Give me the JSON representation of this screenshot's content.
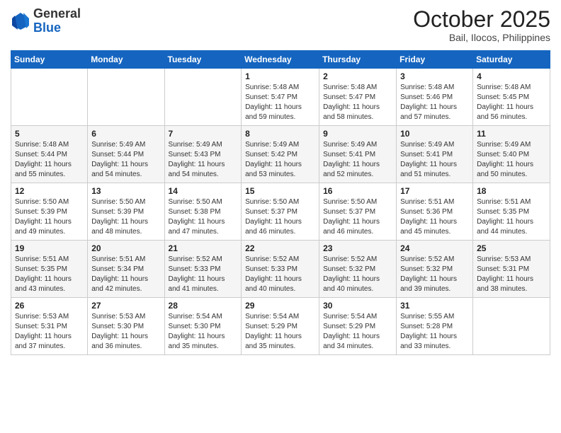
{
  "header": {
    "logo_general": "General",
    "logo_blue": "Blue",
    "month_year": "October 2025",
    "location": "Bail, Ilocos, Philippines"
  },
  "weekdays": [
    "Sunday",
    "Monday",
    "Tuesday",
    "Wednesday",
    "Thursday",
    "Friday",
    "Saturday"
  ],
  "weeks": [
    [
      {
        "day": "",
        "info": ""
      },
      {
        "day": "",
        "info": ""
      },
      {
        "day": "",
        "info": ""
      },
      {
        "day": "1",
        "info": "Sunrise: 5:48 AM\nSunset: 5:47 PM\nDaylight: 11 hours\nand 59 minutes."
      },
      {
        "day": "2",
        "info": "Sunrise: 5:48 AM\nSunset: 5:47 PM\nDaylight: 11 hours\nand 58 minutes."
      },
      {
        "day": "3",
        "info": "Sunrise: 5:48 AM\nSunset: 5:46 PM\nDaylight: 11 hours\nand 57 minutes."
      },
      {
        "day": "4",
        "info": "Sunrise: 5:48 AM\nSunset: 5:45 PM\nDaylight: 11 hours\nand 56 minutes."
      }
    ],
    [
      {
        "day": "5",
        "info": "Sunrise: 5:48 AM\nSunset: 5:44 PM\nDaylight: 11 hours\nand 55 minutes."
      },
      {
        "day": "6",
        "info": "Sunrise: 5:49 AM\nSunset: 5:44 PM\nDaylight: 11 hours\nand 54 minutes."
      },
      {
        "day": "7",
        "info": "Sunrise: 5:49 AM\nSunset: 5:43 PM\nDaylight: 11 hours\nand 54 minutes."
      },
      {
        "day": "8",
        "info": "Sunrise: 5:49 AM\nSunset: 5:42 PM\nDaylight: 11 hours\nand 53 minutes."
      },
      {
        "day": "9",
        "info": "Sunrise: 5:49 AM\nSunset: 5:41 PM\nDaylight: 11 hours\nand 52 minutes."
      },
      {
        "day": "10",
        "info": "Sunrise: 5:49 AM\nSunset: 5:41 PM\nDaylight: 11 hours\nand 51 minutes."
      },
      {
        "day": "11",
        "info": "Sunrise: 5:49 AM\nSunset: 5:40 PM\nDaylight: 11 hours\nand 50 minutes."
      }
    ],
    [
      {
        "day": "12",
        "info": "Sunrise: 5:50 AM\nSunset: 5:39 PM\nDaylight: 11 hours\nand 49 minutes."
      },
      {
        "day": "13",
        "info": "Sunrise: 5:50 AM\nSunset: 5:39 PM\nDaylight: 11 hours\nand 48 minutes."
      },
      {
        "day": "14",
        "info": "Sunrise: 5:50 AM\nSunset: 5:38 PM\nDaylight: 11 hours\nand 47 minutes."
      },
      {
        "day": "15",
        "info": "Sunrise: 5:50 AM\nSunset: 5:37 PM\nDaylight: 11 hours\nand 46 minutes."
      },
      {
        "day": "16",
        "info": "Sunrise: 5:50 AM\nSunset: 5:37 PM\nDaylight: 11 hours\nand 46 minutes."
      },
      {
        "day": "17",
        "info": "Sunrise: 5:51 AM\nSunset: 5:36 PM\nDaylight: 11 hours\nand 45 minutes."
      },
      {
        "day": "18",
        "info": "Sunrise: 5:51 AM\nSunset: 5:35 PM\nDaylight: 11 hours\nand 44 minutes."
      }
    ],
    [
      {
        "day": "19",
        "info": "Sunrise: 5:51 AM\nSunset: 5:35 PM\nDaylight: 11 hours\nand 43 minutes."
      },
      {
        "day": "20",
        "info": "Sunrise: 5:51 AM\nSunset: 5:34 PM\nDaylight: 11 hours\nand 42 minutes."
      },
      {
        "day": "21",
        "info": "Sunrise: 5:52 AM\nSunset: 5:33 PM\nDaylight: 11 hours\nand 41 minutes."
      },
      {
        "day": "22",
        "info": "Sunrise: 5:52 AM\nSunset: 5:33 PM\nDaylight: 11 hours\nand 40 minutes."
      },
      {
        "day": "23",
        "info": "Sunrise: 5:52 AM\nSunset: 5:32 PM\nDaylight: 11 hours\nand 40 minutes."
      },
      {
        "day": "24",
        "info": "Sunrise: 5:52 AM\nSunset: 5:32 PM\nDaylight: 11 hours\nand 39 minutes."
      },
      {
        "day": "25",
        "info": "Sunrise: 5:53 AM\nSunset: 5:31 PM\nDaylight: 11 hours\nand 38 minutes."
      }
    ],
    [
      {
        "day": "26",
        "info": "Sunrise: 5:53 AM\nSunset: 5:31 PM\nDaylight: 11 hours\nand 37 minutes."
      },
      {
        "day": "27",
        "info": "Sunrise: 5:53 AM\nSunset: 5:30 PM\nDaylight: 11 hours\nand 36 minutes."
      },
      {
        "day": "28",
        "info": "Sunrise: 5:54 AM\nSunset: 5:30 PM\nDaylight: 11 hours\nand 35 minutes."
      },
      {
        "day": "29",
        "info": "Sunrise: 5:54 AM\nSunset: 5:29 PM\nDaylight: 11 hours\nand 35 minutes."
      },
      {
        "day": "30",
        "info": "Sunrise: 5:54 AM\nSunset: 5:29 PM\nDaylight: 11 hours\nand 34 minutes."
      },
      {
        "day": "31",
        "info": "Sunrise: 5:55 AM\nSunset: 5:28 PM\nDaylight: 11 hours\nand 33 minutes."
      },
      {
        "day": "",
        "info": ""
      }
    ]
  ]
}
